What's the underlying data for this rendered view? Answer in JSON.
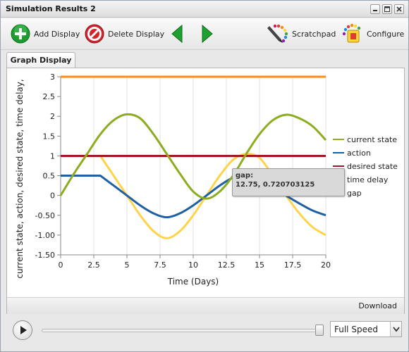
{
  "window": {
    "title": "Simulation Results 2"
  },
  "toolbar": {
    "add_display": "Add Display",
    "delete_display": "Delete Display",
    "scratchpad": "Scratchpad",
    "configure": "Configure"
  },
  "tabs": [
    {
      "label": "Graph Display"
    }
  ],
  "panel": {
    "download_label": "Download"
  },
  "tooltip": {
    "title": "gap:",
    "value": "12.75, 0.720703125"
  },
  "playback": {
    "speed": "Full Speed",
    "position_fraction": 0.98
  },
  "colors": {
    "current_state": "#8bad1e",
    "action": "#1f5fa6",
    "desired_state": "#a3161f",
    "time_delay": "#ffd34a",
    "gap": "#ff8c1a"
  },
  "chart_data": {
    "type": "line",
    "xlabel": "Time (Days)",
    "ylabel": "current state, action, desired state, time delay,",
    "xlim": [
      0,
      20
    ],
    "ylim": [
      -1.5,
      3
    ],
    "xticks": [
      "0",
      "2.5",
      "5",
      "7.5",
      "10",
      "12.5",
      "15",
      "17.5",
      "20"
    ],
    "yticks": [
      "3",
      "2.5",
      "2",
      "1.5",
      "1",
      "0.5",
      "0",
      "-0.50",
      "-1.00",
      "-1.50"
    ],
    "grid": "vertical",
    "legend_position": "right",
    "series": [
      {
        "name": "current state",
        "color": "#8bad1e",
        "x": [
          0,
          1,
          2,
          3,
          4,
          5,
          6,
          7,
          8,
          9,
          10,
          11,
          12,
          13,
          14,
          15,
          16,
          17,
          18,
          19,
          20
        ],
        "y": [
          0,
          0.55,
          1.05,
          1.55,
          1.9,
          2.05,
          1.95,
          1.55,
          1.05,
          0.55,
          0.1,
          -0.08,
          0.1,
          0.5,
          1.05,
          1.55,
          1.9,
          2.04,
          1.95,
          1.75,
          1.4
        ]
      },
      {
        "name": "action",
        "color": "#1f5fa6",
        "x": [
          0,
          3,
          4,
          5,
          6,
          7,
          8,
          9,
          10,
          11,
          12,
          13,
          14,
          15,
          16,
          17,
          18,
          19,
          20
        ],
        "y": [
          0.5,
          0.5,
          0.25,
          0,
          -0.25,
          -0.45,
          -0.55,
          -0.45,
          -0.25,
          0,
          0.25,
          0.45,
          0.52,
          0.45,
          0.25,
          0,
          -0.2,
          -0.38,
          -0.5
        ]
      },
      {
        "name": "desired state",
        "color": "#a3161f",
        "x": [
          0,
          20
        ],
        "y": [
          1,
          1
        ]
      },
      {
        "name": "time delay",
        "color": "#ffd34a",
        "x": [
          3,
          4,
          5,
          6,
          7,
          8,
          9,
          10,
          11,
          12,
          13,
          14,
          15,
          16,
          17,
          18,
          19,
          20
        ],
        "y": [
          1,
          0.5,
          0,
          -0.5,
          -0.9,
          -1.08,
          -0.9,
          -0.5,
          0,
          0.5,
          0.9,
          1.05,
          0.95,
          0.5,
          0,
          -0.45,
          -0.8,
          -1.0
        ]
      },
      {
        "name": "gap",
        "color": "#ff8c1a",
        "x": [
          0,
          20
        ],
        "y": [
          3,
          3
        ]
      }
    ]
  }
}
